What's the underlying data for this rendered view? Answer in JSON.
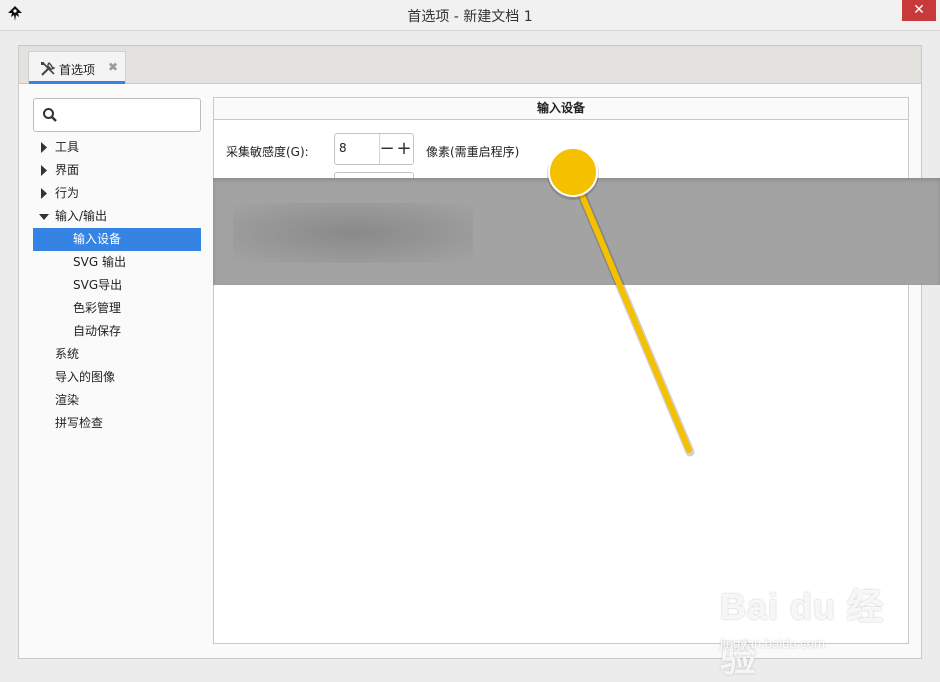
{
  "window": {
    "title": "首选项 - 新建文档 1",
    "close_glyph": "✕"
  },
  "tabs": [
    {
      "label": "首选项",
      "icon": "tools-icon",
      "close_glyph": "✖"
    }
  ],
  "search": {
    "placeholder": "",
    "icon": "search-icon"
  },
  "sidebar": {
    "items": [
      {
        "label": "工具",
        "expander": "collapsed"
      },
      {
        "label": "界面",
        "expander": "collapsed"
      },
      {
        "label": "行为",
        "expander": "collapsed"
      },
      {
        "label": "输入/输出",
        "expander": "expanded"
      },
      {
        "label": "输入设备",
        "child": true,
        "selected": true
      },
      {
        "label": "SVG 输出",
        "child": true
      },
      {
        "label": "SVG导出",
        "child": true
      },
      {
        "label": "色彩管理",
        "child": true
      },
      {
        "label": "自动保存",
        "child": true
      },
      {
        "label": "系统"
      },
      {
        "label": "导入的图像"
      },
      {
        "label": "渲染"
      },
      {
        "label": "拼写检查"
      }
    ]
  },
  "panel": {
    "title": "输入设备",
    "grab_sensitivity": {
      "label": "采集敏感度(G):",
      "value": "8",
      "minus": "−",
      "plus": "+",
      "unit": "像素(需重启程序)"
    }
  },
  "watermark": {
    "brand": "Bai du 经验",
    "url": "jingyan.baidu.com"
  },
  "colors": {
    "accent": "#3584e4",
    "close": "#c7393a",
    "pointer": "#f5c000"
  }
}
